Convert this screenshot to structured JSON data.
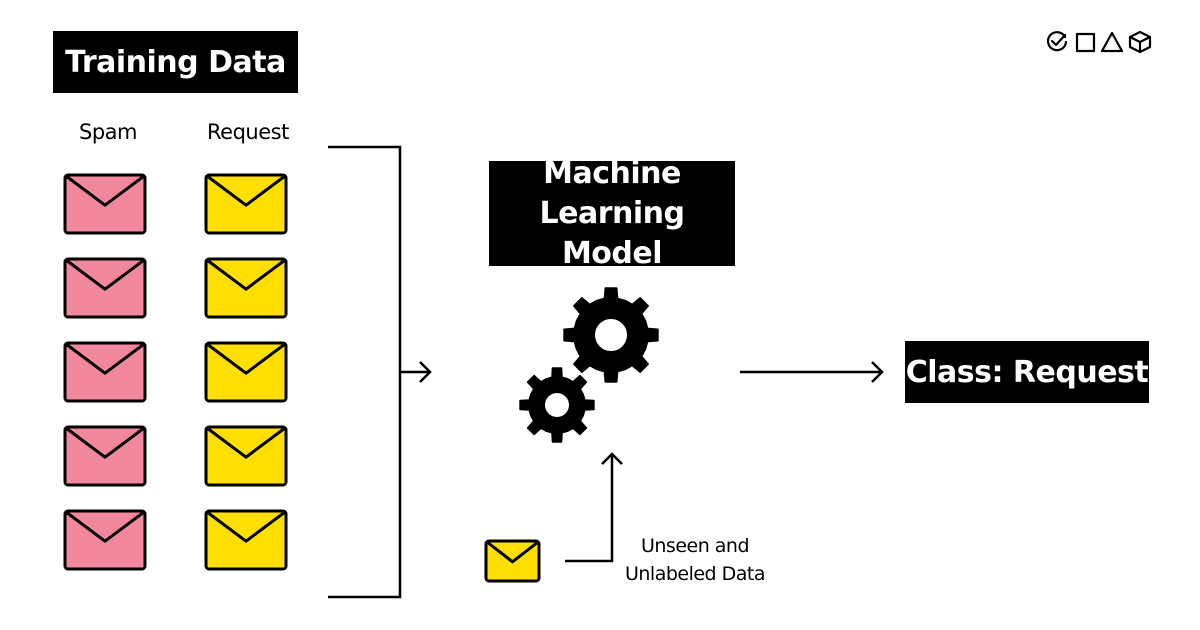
{
  "colors": {
    "spam": "#F2889E",
    "request": "#FFDF00",
    "box_bg": "#000000",
    "box_text": "#FFFFFF",
    "stroke": "#000000"
  },
  "logo": {
    "icons": [
      "check-circle-icon",
      "square-icon",
      "triangle-icon",
      "cube-icon"
    ]
  },
  "training": {
    "title": "Training Data",
    "columns": [
      {
        "label": "Spam",
        "class": "spam",
        "count": 5
      },
      {
        "label": "Request",
        "class": "request",
        "count": 5
      }
    ]
  },
  "model": {
    "title_line1": "Machine",
    "title_line2": "Learning Model",
    "icon": "gears-icon"
  },
  "input": {
    "label_line1": "Unseen and",
    "label_line2": "Unlabeled Data",
    "class": "request"
  },
  "output": {
    "title": "Class: Request"
  }
}
